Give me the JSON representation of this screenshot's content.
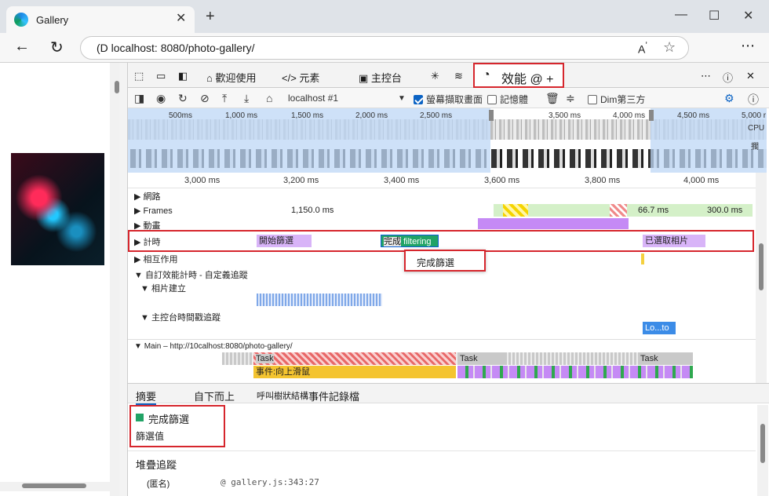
{
  "browser": {
    "tab_title": "Gallery",
    "url": "(D localhost: 8080/photo-gallery/"
  },
  "devtools": {
    "tabs": {
      "welcome": "歡迎使用",
      "elements": "元素",
      "console": "主控台",
      "performance": "效能 @ +"
    },
    "toolbar": {
      "target": "localhost #1",
      "screenshots": "螢幕擷取畫面",
      "memory": "記憶體",
      "dim": "Dim第三方"
    },
    "overview_ticks": [
      "500ms",
      "1,000 ms",
      "1,500 ms",
      "2,000 ms",
      "2,500 ms",
      "3,500 ms",
      "4,000 ms",
      "4,500 ms",
      "5,000 r"
    ],
    "overview_side": {
      "cpu": "CPU",
      "net": "擱"
    },
    "ruler_ticks": [
      "3,000 ms",
      "3,200 ms",
      "3,400 ms",
      "3,600 ms",
      "3,800 ms",
      "4,000 ms"
    ],
    "tracks": {
      "network": "網路",
      "frames": "Frames",
      "frames_time_1": "1,150.0 ms",
      "frames_time_2": "66.7 ms",
      "frames_time_3": "300.0 ms",
      "animations": "動畫",
      "timings": "計時",
      "timing_start": "開始篩選",
      "timing_done": "完成",
      "timing_filtering": "filtering",
      "timing_selected": "已選取相片",
      "interactions": "相互作用",
      "custom": "自訂效能計時 - 自定義追蹤",
      "photo_build": "相片建立",
      "console_track": "主控台時間戳追蹤",
      "console_item": "Lo...to",
      "main": "Main – http://10calhost:8080/photo-gallery/",
      "task": "Task",
      "event": "事件:向上滑鼠"
    },
    "tooltip": "完成篩選",
    "bottom_tabs": [
      "摘要",
      "自下而上",
      "呼叫樹狀結構",
      "事件記錄檔"
    ],
    "summary": {
      "title": "完成篩選",
      "subtitle": "篩選值",
      "stack_heading": "堆疊追蹤",
      "frame_name": "(匿名)",
      "frame_loc": "@ gallery.js:343:27"
    }
  }
}
